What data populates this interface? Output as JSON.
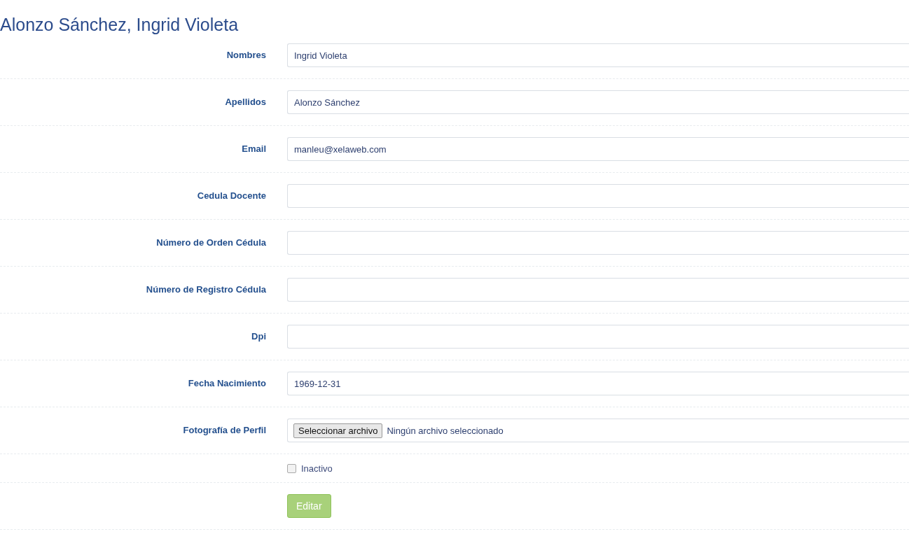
{
  "title": "Alonzo Sánchez, Ingrid Violeta",
  "fields": [
    {
      "kind": "text",
      "label": "Nombres",
      "value": "Ingrid Violeta"
    },
    {
      "kind": "text",
      "label": "Apellidos",
      "value": "Alonzo Sánchez"
    },
    {
      "kind": "text",
      "label": "Email",
      "value": "manleu@xelaweb.com"
    },
    {
      "kind": "text",
      "label": "Cedula Docente"
    },
    {
      "kind": "text",
      "label": "Número de Orden Cédula"
    },
    {
      "kind": "text",
      "label": "Número de Registro Cédula"
    },
    {
      "kind": "text",
      "label": "Dpi"
    },
    {
      "kind": "text",
      "label": "Fecha Nacimiento",
      "value": "1969-12-31"
    },
    {
      "kind": "file",
      "label": "Fotografía de Perfil",
      "button": "Seleccionar archivo",
      "status": "Ningún archivo seleccionado"
    }
  ],
  "inactive": {
    "label": "Inactivo",
    "checked": false
  },
  "submit": "Editar"
}
